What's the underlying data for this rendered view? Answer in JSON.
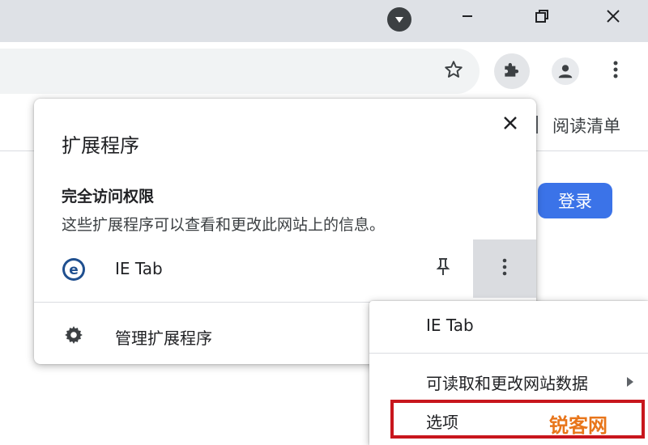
{
  "window": {
    "minimize_icon": "minimize-icon",
    "restore_icon": "restore-icon",
    "close_icon": "close-icon"
  },
  "toolbar": {
    "star_icon": "star-icon",
    "extensions_icon": "puzzle-icon",
    "profile_icon": "person-icon",
    "menu_icon": "kebab-icon"
  },
  "bookmarks": {
    "reading_list": "阅读清单"
  },
  "page": {
    "login_button": "登录"
  },
  "extensions_popup": {
    "title": "扩展程序",
    "full_access_heading": "完全访问权限",
    "full_access_desc": "这些扩展程序可以查看和更改此网站上的信息。",
    "extension_name": "IE Tab",
    "manage_label": "管理扩展程序"
  },
  "context_menu": {
    "header": "IE Tab",
    "site_access": "可读取和更改网站数据",
    "options": "选项"
  },
  "watermark": "锐客网",
  "colors": {
    "accent": "#3b73e8",
    "highlight_border": "#c8161d",
    "watermark": "#e8751a"
  }
}
